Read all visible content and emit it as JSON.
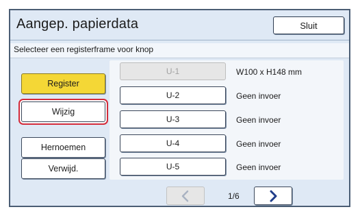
{
  "dialog": {
    "title": "Aangep. papierdata",
    "close_label": "Sluit",
    "instruction": "Selecteer een registerframe voor knop"
  },
  "actions": [
    {
      "label": "Register",
      "state": "highlighted"
    },
    {
      "label": "Wijzig",
      "state": "selected"
    },
    {
      "label": "Hernoemen",
      "state": "normal"
    },
    {
      "label": "Verwijd.",
      "state": "normal"
    }
  ],
  "slots": [
    {
      "name": "U-1",
      "info": "W100 x H148 mm",
      "disabled": true
    },
    {
      "name": "U-2",
      "info": "Geen invoer",
      "disabled": false
    },
    {
      "name": "U-3",
      "info": "Geen invoer",
      "disabled": false
    },
    {
      "name": "U-4",
      "info": "Geen invoer",
      "disabled": false
    },
    {
      "name": "U-5",
      "info": "Geen invoer",
      "disabled": false
    }
  ],
  "pager": {
    "indicator": "1/6",
    "prev_icon": "chevron-left-icon",
    "next_icon": "chevron-right-icon",
    "prev_disabled": true
  },
  "colors": {
    "background": "#dfe9f5",
    "register_button": "#f4d736",
    "selection_outline": "#d32b3a",
    "accent": "#1f3d8a"
  }
}
